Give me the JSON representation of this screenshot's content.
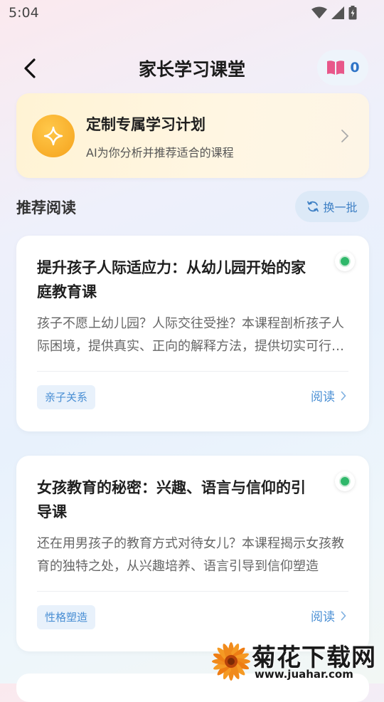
{
  "status_bar": {
    "time": "5:04"
  },
  "header": {
    "title": "家长学习课堂",
    "book_count": "0"
  },
  "plan_card": {
    "title": "定制专属学习计划",
    "subtitle": "AI为你分析并推荐适合的课程"
  },
  "section": {
    "title": "推荐阅读",
    "refresh_label": "换一批"
  },
  "cards": [
    {
      "title": "提升孩子人际适应力：从幼儿园开始的家庭教育课",
      "description": "孩子不愿上幼儿园？人际交往受挫？本课程剖析孩子人际困境，提供真实、正向的解释方法，提供切实可行的引导策略",
      "tag": "亲子关系",
      "read_label": "阅读"
    },
    {
      "title": "女孩教育的秘密：兴趣、语言与信仰的引导课",
      "description": "还在用男孩子的教育方式对待女儿？本课程揭示女孩教育的独特之处，从兴趣培养、语言引导到信仰塑造",
      "tag": "性格塑造",
      "read_label": "阅读"
    }
  ],
  "watermark": {
    "text": "菊花下载网",
    "url": "www.juahar.com"
  },
  "colors": {
    "accent": "#4a8fd4",
    "selected": "#2fb86a",
    "plan_icon": "#f5a21c"
  }
}
